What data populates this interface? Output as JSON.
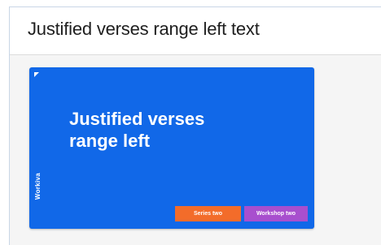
{
  "header": {
    "title": "Justified verses range left text"
  },
  "slide": {
    "title_line1": "Justified verses",
    "title_line2": "range left",
    "brand": "Workiva",
    "tags": [
      {
        "label": "Series two",
        "color": "#f36c2a"
      },
      {
        "label": "Workshop two",
        "color": "#a84fce"
      }
    ],
    "background_color": "#1168e8"
  }
}
